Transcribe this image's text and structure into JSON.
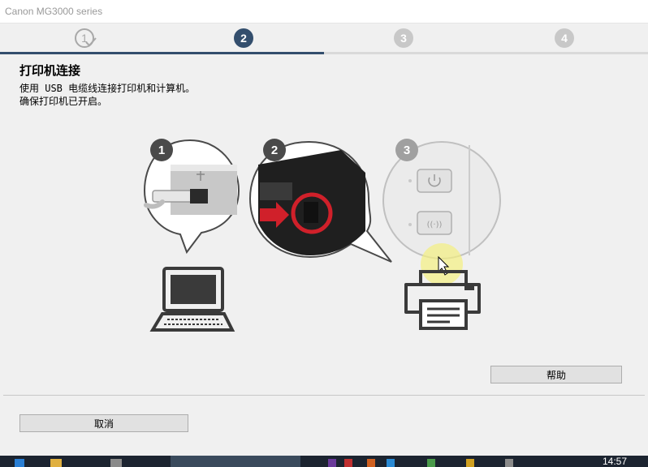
{
  "window": {
    "title": "Canon MG3000 series"
  },
  "steps": [
    {
      "label": "1",
      "state": "done"
    },
    {
      "label": "2",
      "state": "active"
    },
    {
      "label": "3",
      "state": "pending"
    },
    {
      "label": "4",
      "state": "pending"
    }
  ],
  "progress": {
    "fraction": 0.5
  },
  "page": {
    "heading": "打印机连接",
    "description_line1": "使用 USB 电缆线连接打印机和计算机。",
    "description_line2": "确保打印机已开启。"
  },
  "illustration": {
    "callout_1": "1",
    "callout_2": "2",
    "callout_3": "3",
    "icons": [
      "usb-cable-icon",
      "usb-port-icon",
      "power-button-icon",
      "wifi-button-icon",
      "laptop-icon",
      "printer-icon"
    ]
  },
  "buttons": {
    "help": "帮助",
    "cancel": "取消"
  },
  "taskbar": {
    "clock": "14:57"
  },
  "colors": {
    "accent": "#334e6d",
    "pending": "#c8c8c8",
    "callout_red": "#d0202a"
  }
}
